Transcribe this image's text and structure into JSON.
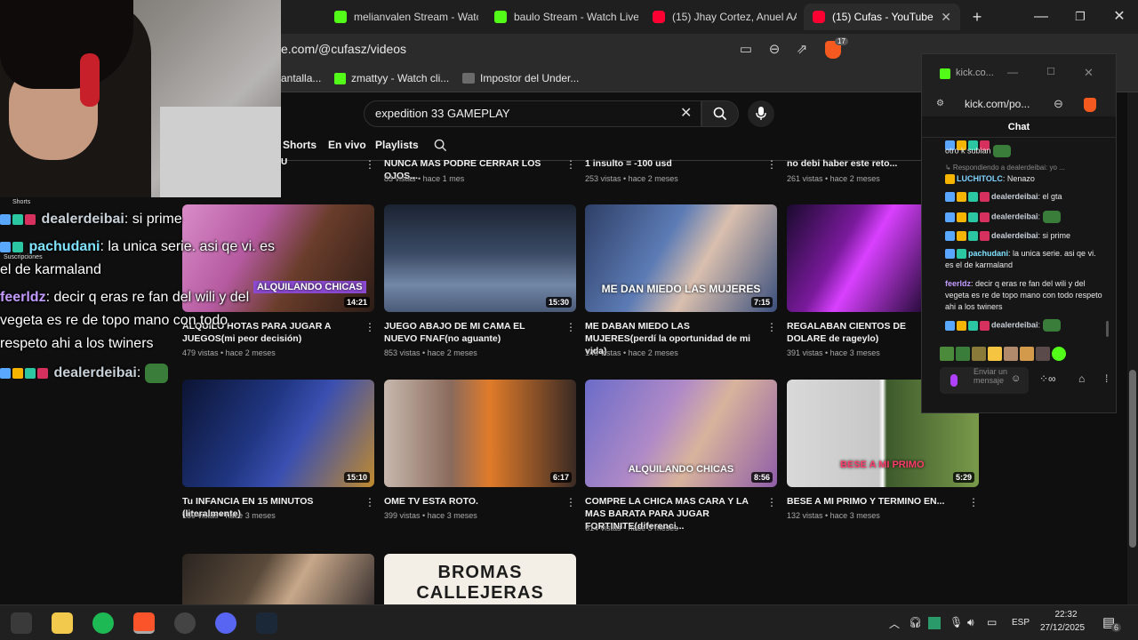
{
  "tabs": [
    {
      "label": "melianvalen Stream - Watc",
      "favicon": "kick-icon"
    },
    {
      "label": "baulo Stream - Watch Live",
      "favicon": "kick-icon"
    },
    {
      "label": "(15) Jhay Cortez, Anuel AA",
      "favicon": "youtube-icon"
    },
    {
      "label": "(15) Cufas - YouTube",
      "favicon": "youtube-icon",
      "active": true
    }
  ],
  "address": {
    "url": "e.com/@cufasz/videos"
  },
  "bookmarks": [
    {
      "label": "antalla..."
    },
    {
      "label": "zmattyy - Watch cli..."
    },
    {
      "label": "Impostor del Under..."
    }
  ],
  "brave_badge": "17",
  "search": {
    "value": "expedition 33 GAMEPLAY"
  },
  "channel_tabs": [
    "Shorts",
    "En vivo",
    "Playlists"
  ],
  "top_row": [
    {
      "title": "NUNCA MAS PODRE CERRAR LOS OJOS...",
      "meta": "83 vistas • hace 1 mes"
    },
    {
      "title": "1 insulto = -100 usd",
      "meta": "253 vistas • hace 2 meses"
    },
    {
      "title": "no debi haber este reto...",
      "meta": "261 vistas • hace 2 meses"
    }
  ],
  "videos": [
    {
      "title": "ALQUILO HOTAS PARA JUGAR A JUEGOS(mi peor decisión)",
      "meta": "479 vistas • hace 2 meses",
      "duration": "14:21",
      "overlay": "ALQUILANDO CHICAS"
    },
    {
      "title": "JUEGO ABAJO DE MI CAMA EL NUEVO FNAF(no aguante)",
      "meta": "853 vistas • hace 2 meses",
      "duration": "15:30",
      "overlay": ""
    },
    {
      "title": "ME DABAN MIEDO LAS MUJERES(perdí la oportunidad de mi vida)",
      "meta": "146 vistas • hace 2 meses",
      "duration": "7:15",
      "overlay": "ME DAN MIEDO LAS MUJERES"
    },
    {
      "title": "REGALABAN CIENTOS DE DOLARE de rageylo)",
      "meta": "391 vistas • hace 3 meses",
      "duration": "",
      "overlay": ""
    },
    {
      "title": "Tu INFANCIA EN 15 MINUTOS (literalmente)",
      "meta": "189 vistas • hace 3 meses",
      "duration": "15:10",
      "overlay": ""
    },
    {
      "title": "OME TV ESTA ROTO.",
      "meta": "399 vistas • hace 3 meses",
      "duration": "6:17",
      "overlay": ""
    },
    {
      "title": "COMPRE LA CHICA MAS CARA Y LA MAS BARATA PARA JUGAR FORTINITE(diferenci...",
      "meta": "614 vistas • hace 3 meses",
      "duration": "8:56",
      "overlay": "ALQUILANDO CHICAS"
    },
    {
      "title": "BESE A MI PRIMO Y TERMINO EN...",
      "meta": "132 vistas • hace 3 meses",
      "duration": "5:29",
      "overlay": "BESE A MI PRIMO"
    }
  ],
  "bottom_row": [
    {
      "overlay": ""
    },
    {
      "overlay": "BROMAS CALLEJERAS"
    }
  ],
  "sidebar_labels": {
    "shorts": "Shorts",
    "subs": "Suscripciones"
  },
  "overlay_chat": [
    {
      "user": "dealerdeibai",
      "user_color": "#c8d0d8",
      "text": ": si prime"
    },
    {
      "user": "pachudani",
      "user_color": "#7fe3ff",
      "text": ": la unica serie. asi qe vi. es"
    },
    {
      "user": "",
      "user_color": "",
      "text": "el de karmaland"
    },
    {
      "user": "feerldz",
      "user_color": "#c39bff",
      "text": ": decir q eras re fan del wili y del"
    },
    {
      "user": "",
      "user_color": "",
      "text": "vegeta es re de topo mano con todo"
    },
    {
      "user": "",
      "user_color": "",
      "text": "respeto ahi a los twiners"
    },
    {
      "user": "dealerdeibai",
      "user_color": "#c8d0d8",
      "text": ":"
    }
  ],
  "kick_popup": {
    "title": "kick.co...",
    "url": "kick.com/po...",
    "heading": "Chat",
    "reply_line": "↳ Respondiendo a dealerdeibai: yo ...",
    "messages": [
      {
        "text": "otro k subian"
      },
      {
        "user": "LUCHITOLC",
        "user_color": "#7fd3ff",
        "text": ": Nenazo"
      },
      {
        "user": "dealerdeibai",
        "user_color": "#c8d0d8",
        "text": ": el gta"
      },
      {
        "user": "dealerdeibai",
        "user_color": "#c8d0d8",
        "text": ":"
      },
      {
        "user": "dealerdeibai",
        "user_color": "#c8d0d8",
        "text": ": si prime"
      },
      {
        "user": "pachudani",
        "user_color": "#7fe3ff",
        "text": ": la unica serie. asi qe vi. es el de karmaland"
      },
      {
        "user": "feerldz",
        "user_color": "#c39bff",
        "text": ": decir q eras re fan del wili y del vegeta es re de topo mano con todo respeto ahi a los twiners"
      },
      {
        "user": "dealerdeibai",
        "user_color": "#c8d0d8",
        "text": ":"
      }
    ],
    "input_placeholder": "Enviar un mensaje"
  },
  "taskbar": {
    "language": "ESP",
    "time": "22:32",
    "date": "27/12/2025",
    "notification_count": "6"
  },
  "colors": {
    "accent": "#53fc18",
    "youtube_red": "#ff0033",
    "bg": "#0f0f0f"
  }
}
